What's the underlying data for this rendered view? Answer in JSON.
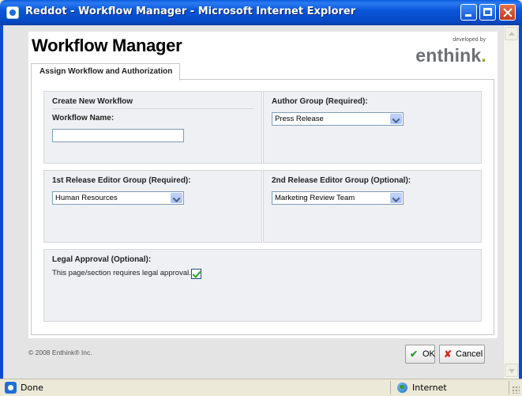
{
  "window": {
    "title": "Reddot - Workflow Manager - Microsoft Internet Explorer"
  },
  "header": {
    "app_title": "Workflow Manager",
    "developed_by": "developed by",
    "logo_text": "enthink",
    "logo_dot": "."
  },
  "tabs": [
    {
      "label": "Assign Workflow and Authorization",
      "active": true
    }
  ],
  "form": {
    "create_workflow": {
      "section_label": "Create New Workflow",
      "name_label": "Workflow Name:",
      "name_value": ""
    },
    "author_group": {
      "label": "Author Group (Required):",
      "selected": "Press Release"
    },
    "first_release_editor": {
      "label": "1st Release Editor Group (Required):",
      "selected": "Human Resources"
    },
    "second_release_editor": {
      "label": "2nd Release Editor Group (Optional):",
      "selected": "Marketing Review Team"
    },
    "legal_approval": {
      "label": "Legal Approval (Optional):",
      "text": "This page/section requires legal approval.",
      "checked": true
    }
  },
  "footer": {
    "copyright": "© 2008 Enthink® Inc.",
    "ok_label": "OK",
    "cancel_label": "Cancel"
  },
  "statusbar": {
    "status": "Done",
    "zone": "Internet"
  },
  "colors": {
    "titlebar": "#0a57d9",
    "logo_accent": "#7ab51d",
    "ok_check": "#27a327",
    "cancel_x": "#d62b1f"
  }
}
